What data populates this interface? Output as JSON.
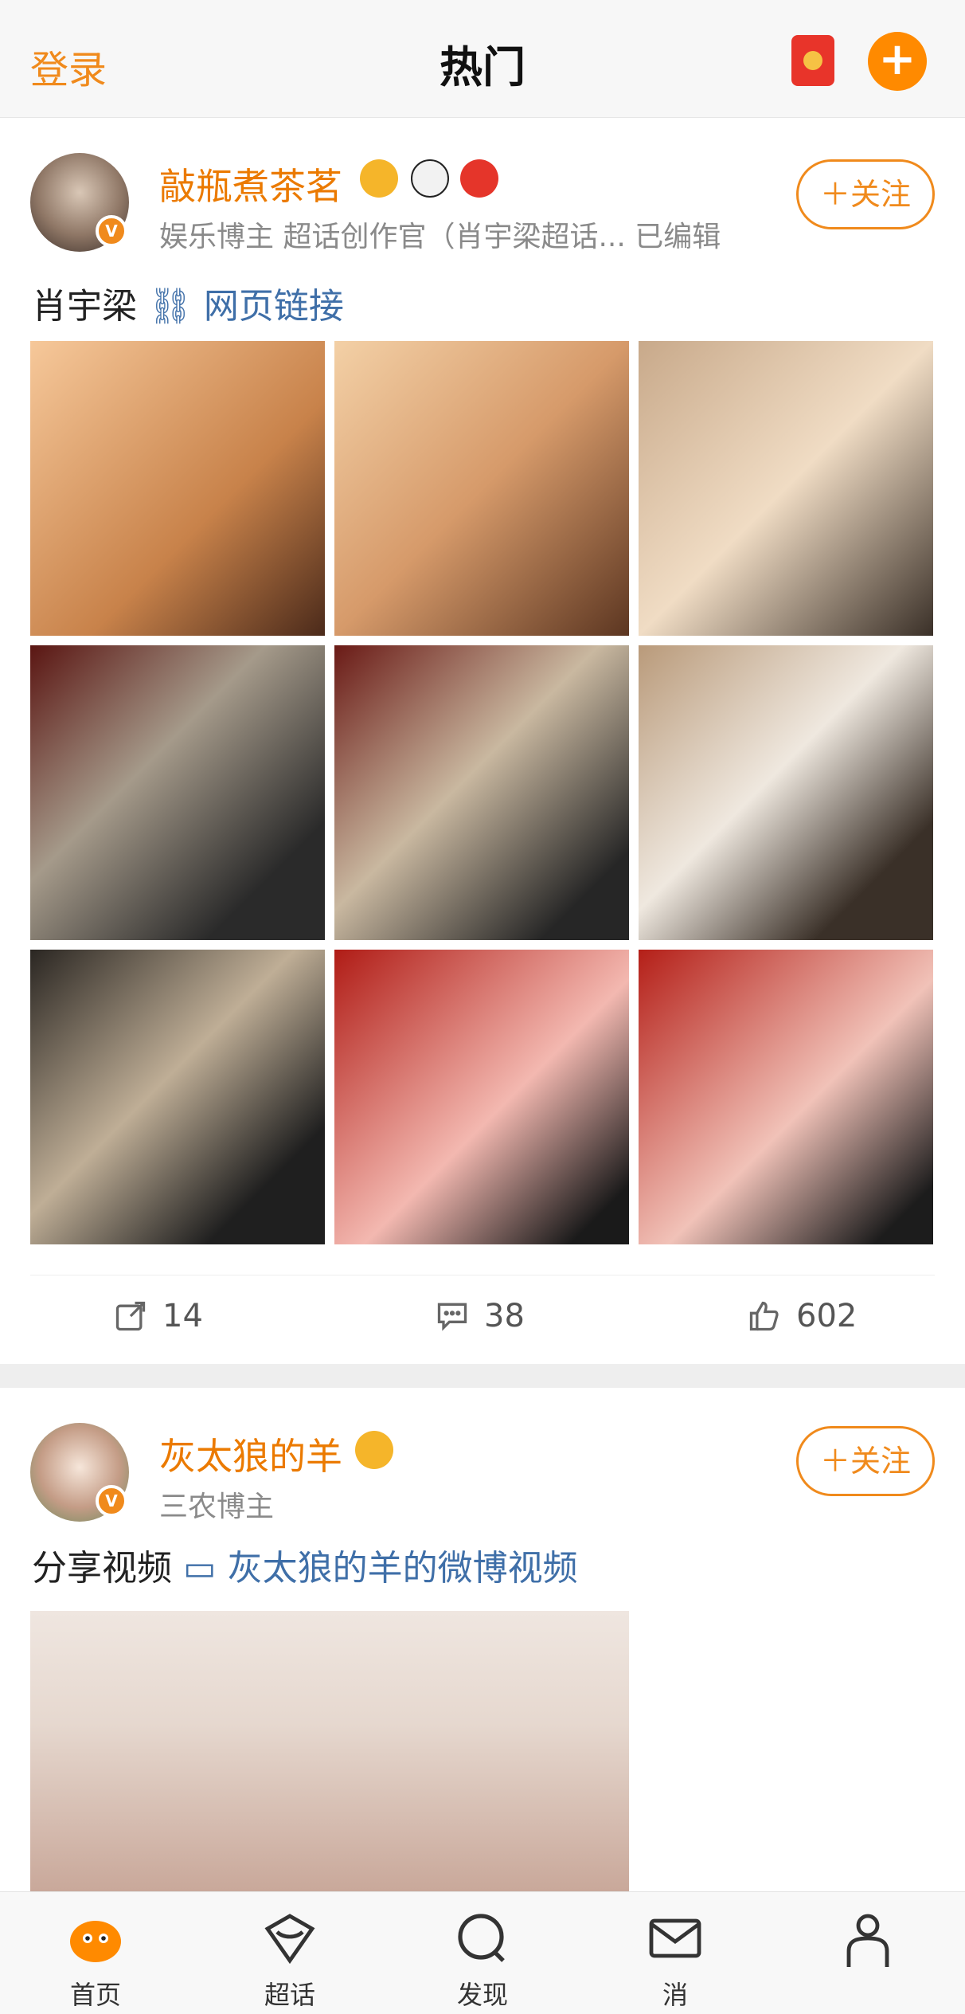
{
  "header": {
    "login_label": "登录",
    "title": "热门",
    "accent_color": "#ffb820",
    "brand_orange": "#ff8a00",
    "redpacket_icon": "red-packet-icon",
    "plus_icon": "plus-icon"
  },
  "posts": [
    {
      "username": "敲瓶煮茶茗",
      "meta": "娱乐博主 超话创作官（肖宇梁超话...   已编辑",
      "follow_label": "＋关注",
      "text": "肖宇梁",
      "link_text": "网页链接",
      "badges": [
        "crown-icon",
        "panda-icon",
        "lantern-icon"
      ],
      "image_count": 9,
      "repost_count": "14",
      "comment_count": "38",
      "like_count": "602"
    },
    {
      "username": "灰太狼的羊",
      "meta": "三农博主",
      "follow_label": "＋关注",
      "text": "分享视频",
      "link_text": "灰太狼的羊的微博视频",
      "badges": [
        "crown-icon"
      ]
    }
  ],
  "bottom_nav": [
    {
      "label": "首页",
      "icon": "home-icon"
    },
    {
      "label": "超话",
      "icon": "super-topic-icon"
    },
    {
      "label": "发现",
      "icon": "search-icon"
    },
    {
      "label": "消",
      "icon": "mail-icon"
    },
    {
      "label": "",
      "icon": "profile-icon"
    }
  ]
}
